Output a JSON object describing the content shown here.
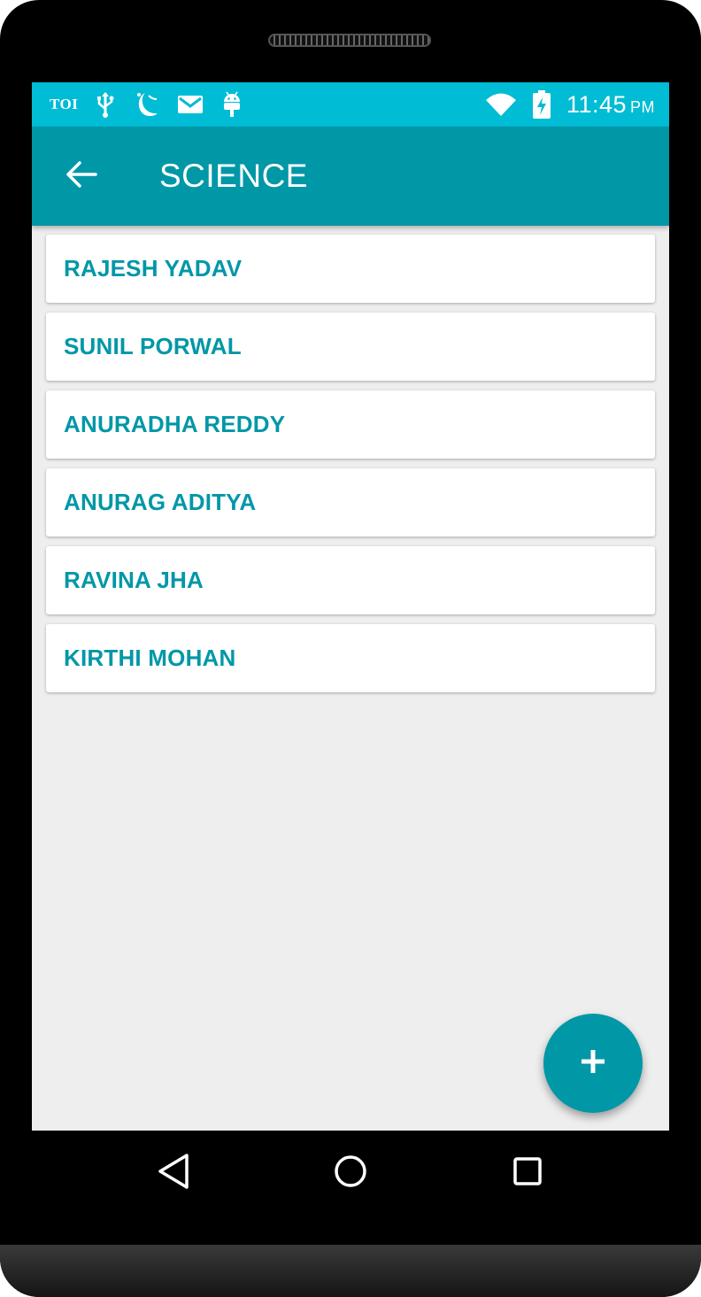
{
  "status_bar": {
    "notification_text": "TOI",
    "notification_icons": [
      "usb-icon",
      "moon-icon",
      "mail-icon",
      "android-icon"
    ],
    "wifi_icon": "wifi-icon",
    "battery_icon": "battery-charging-icon",
    "time": "11:45",
    "ampm": "PM"
  },
  "app_bar": {
    "back_icon": "arrow-left-icon",
    "title": "SCIENCE"
  },
  "list": {
    "items": [
      {
        "label": "RAJESH YADAV"
      },
      {
        "label": "SUNIL PORWAL"
      },
      {
        "label": "ANURADHA REDDY"
      },
      {
        "label": "ANURAG ADITYA"
      },
      {
        "label": "RAVINA JHA"
      },
      {
        "label": "KIRTHI MOHAN"
      }
    ]
  },
  "fab": {
    "icon": "plus-icon"
  },
  "navigation_bar": {
    "icons": [
      "back-triangle-icon",
      "home-circle-icon",
      "recents-square-icon"
    ]
  },
  "colors": {
    "status_bar": "#00bcd4",
    "app_bar": "#0097a7",
    "accent_text": "#0097a7",
    "background": "#eeeeee",
    "card": "#ffffff"
  }
}
